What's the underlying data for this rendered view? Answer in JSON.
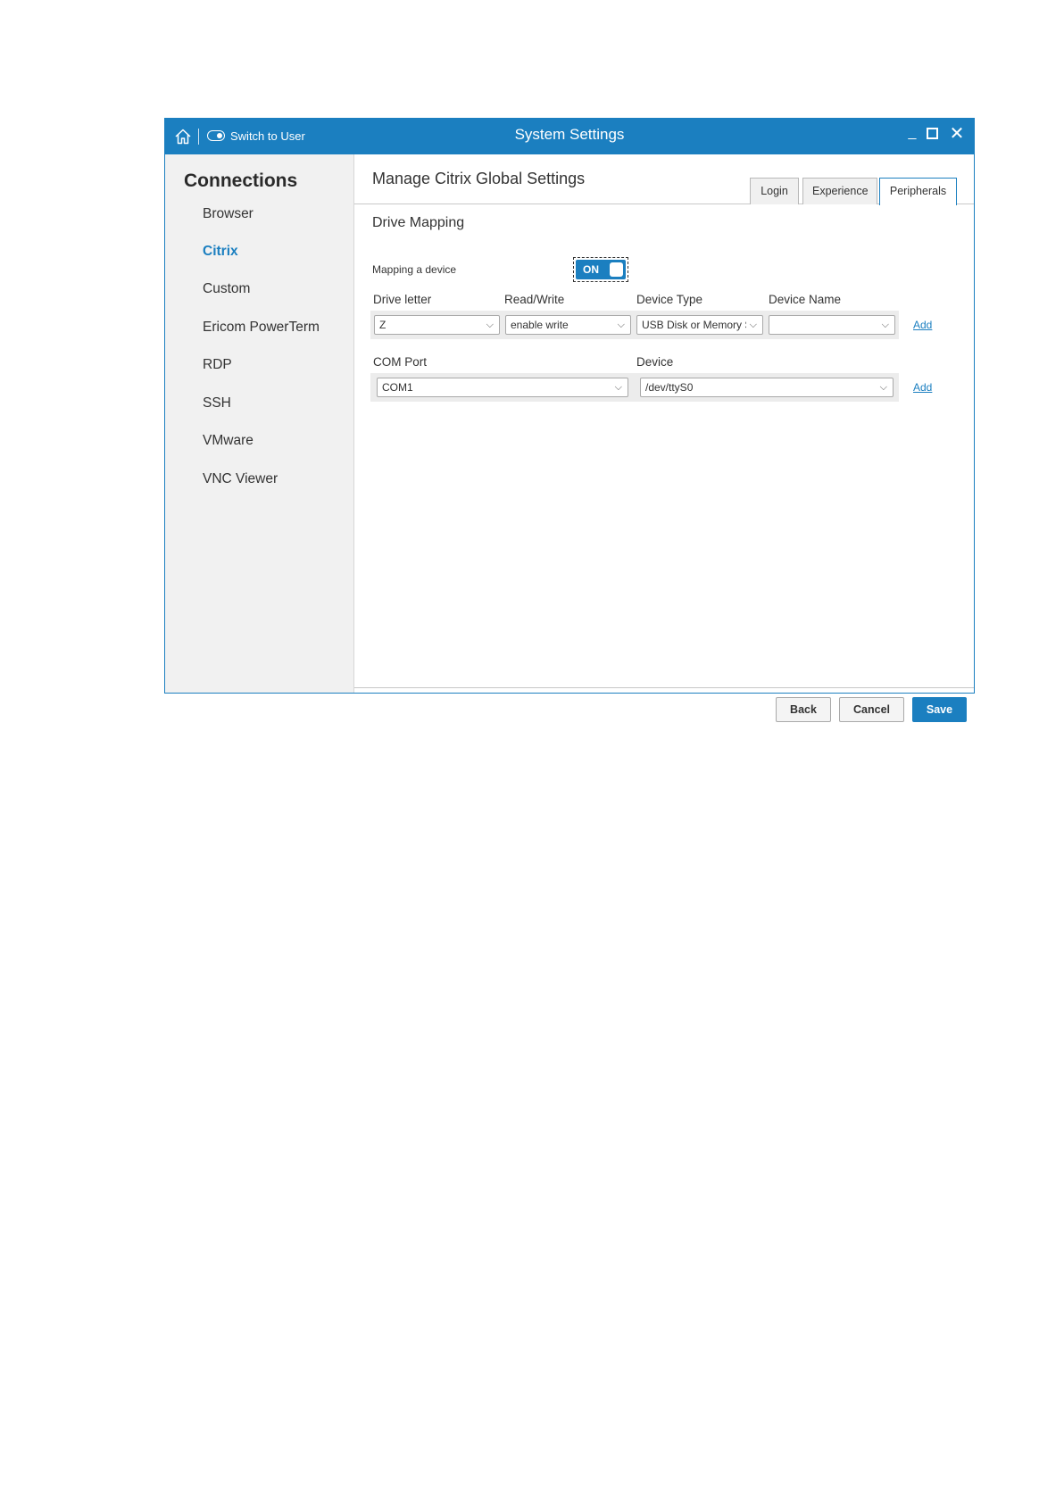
{
  "titlebar": {
    "home_icon": "home-icon",
    "switch_label": "Switch to User",
    "title": "System Settings",
    "min_label": "_"
  },
  "sidebar": {
    "title": "Connections",
    "items": [
      {
        "label": "Browser",
        "active": false
      },
      {
        "label": "Citrix",
        "active": true
      },
      {
        "label": "Custom",
        "active": false
      },
      {
        "label": "Ericom PowerTerm",
        "active": false
      },
      {
        "label": "RDP",
        "active": false
      },
      {
        "label": "SSH",
        "active": false
      },
      {
        "label": "VMware",
        "active": false
      },
      {
        "label": "VNC Viewer",
        "active": false
      }
    ]
  },
  "main": {
    "title": "Manage Citrix Global Settings",
    "tabs": [
      {
        "label": "Login",
        "active": false
      },
      {
        "label": "Experience",
        "active": false
      },
      {
        "label": "Peripherals",
        "active": true
      }
    ],
    "section_title": "Drive Mapping",
    "mapping": {
      "label": "Mapping a device",
      "toggle_text": "ON"
    },
    "drive": {
      "headers": [
        "Drive letter",
        "Read/Write",
        "Device Type",
        "Device Name"
      ],
      "values": [
        "Z",
        "enable write",
        "USB Disk or Memory Stick",
        ""
      ],
      "add_label": "Add"
    },
    "com": {
      "headers": [
        "COM Port",
        "Device"
      ],
      "values": [
        "COM1",
        "/dev/ttyS0"
      ],
      "add_label": "Add"
    }
  },
  "footer": {
    "back_label": "Back",
    "cancel_label": "Cancel",
    "save_label": "Save"
  },
  "colors": {
    "accent": "#1b7fc0",
    "sidebar_bg": "#f1f1f1"
  }
}
